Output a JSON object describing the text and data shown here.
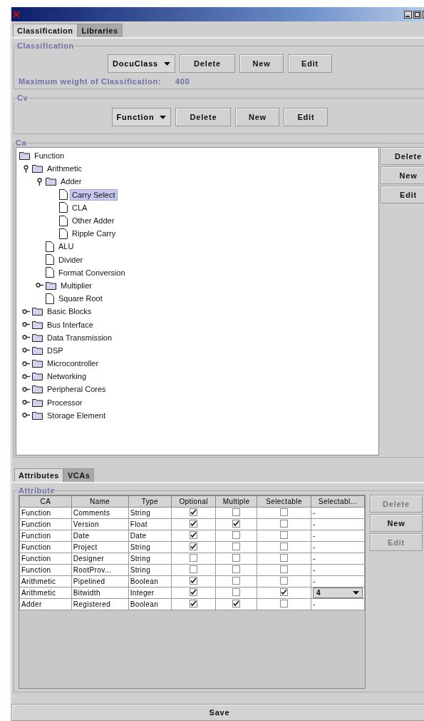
{
  "tabs": [
    {
      "label": "Classification",
      "selected": true
    },
    {
      "label": "Libraries",
      "selected": false
    }
  ],
  "classification": {
    "title": "Classification",
    "dropdown": "DocuClass",
    "buttons": [
      {
        "label": "Delete",
        "disabled": false
      },
      {
        "label": "New",
        "disabled": false
      },
      {
        "label": "Edit",
        "disabled": false
      }
    ],
    "weight_label": "Maximum weight of Classification:",
    "weight_value": "400"
  },
  "cv": {
    "title": "Cv",
    "dropdown": "Function",
    "buttons": [
      {
        "label": "Delete",
        "disabled": false
      },
      {
        "label": "New",
        "disabled": false
      },
      {
        "label": "Edit",
        "disabled": false
      }
    ]
  },
  "ca": {
    "title": "Ca",
    "buttons": [
      {
        "label": "Delete",
        "disabled": false
      },
      {
        "label": "New",
        "disabled": false
      },
      {
        "label": "Edit",
        "disabled": false
      }
    ],
    "tree": {
      "label": "Function",
      "kind": "folder",
      "selected": false,
      "children": [
        {
          "label": "Arithmetic",
          "kind": "folder",
          "expanded": true,
          "selected": false,
          "children": [
            {
              "label": "Adder",
              "kind": "folder",
              "expanded": true,
              "selected": false,
              "children": [
                {
                  "label": "Carry Select",
                  "kind": "leaf",
                  "selected": true
                },
                {
                  "label": "CLA",
                  "kind": "leaf",
                  "selected": false
                },
                {
                  "label": "Other Adder",
                  "kind": "leaf",
                  "selected": false
                },
                {
                  "label": "Ripple Carry",
                  "kind": "leaf",
                  "selected": false
                }
              ]
            },
            {
              "label": "ALU",
              "kind": "leaf",
              "selected": false
            },
            {
              "label": "Divider",
              "kind": "leaf",
              "selected": false
            },
            {
              "label": "Format Conversion",
              "kind": "leaf",
              "selected": false
            },
            {
              "label": "Multiplier",
              "kind": "folder",
              "expanded": false,
              "selected": false
            },
            {
              "label": "Square Root",
              "kind": "leaf",
              "selected": false
            }
          ]
        },
        {
          "label": "Basic Blocks",
          "kind": "folder",
          "expanded": false,
          "selected": false
        },
        {
          "label": "Bus Interface",
          "kind": "folder",
          "expanded": false,
          "selected": false
        },
        {
          "label": "Data Transmission",
          "kind": "folder",
          "expanded": false,
          "selected": false
        },
        {
          "label": "DSP",
          "kind": "folder",
          "expanded": false,
          "selected": false
        },
        {
          "label": "Microcontroller",
          "kind": "folder",
          "expanded": false,
          "selected": false
        },
        {
          "label": "Networking",
          "kind": "folder",
          "expanded": false,
          "selected": false
        },
        {
          "label": "Peripheral Cores",
          "kind": "folder",
          "expanded": false,
          "selected": false
        },
        {
          "label": "Processor",
          "kind": "folder",
          "expanded": false,
          "selected": false
        },
        {
          "label": "Storage Element",
          "kind": "folder",
          "expanded": false,
          "selected": false
        }
      ]
    }
  },
  "sub_tabs": [
    {
      "label": "Attributes",
      "selected": true
    },
    {
      "label": "VCAs",
      "selected": false
    }
  ],
  "attribute": {
    "title": "Attribute",
    "buttons": [
      {
        "label": "Delete",
        "disabled": true
      },
      {
        "label": "New",
        "disabled": false
      },
      {
        "label": "Edit",
        "disabled": true
      }
    ],
    "columns": [
      "CA",
      "Name",
      "Type",
      "Optional",
      "Multiple",
      "Selectable",
      "Selectabl..."
    ],
    "rows": [
      {
        "ca": "Function",
        "name": "Comments",
        "type": "String",
        "optional": true,
        "multiple": false,
        "selectable": false,
        "value": {
          "kind": "text",
          "text": "-"
        }
      },
      {
        "ca": "Function",
        "name": "Version",
        "type": "Float",
        "optional": true,
        "multiple": true,
        "selectable": false,
        "value": {
          "kind": "text",
          "text": "-"
        }
      },
      {
        "ca": "Function",
        "name": "Date",
        "type": "Date",
        "optional": true,
        "multiple": false,
        "selectable": false,
        "value": {
          "kind": "text",
          "text": "-"
        }
      },
      {
        "ca": "Function",
        "name": "Project",
        "type": "String",
        "optional": true,
        "multiple": false,
        "selectable": false,
        "value": {
          "kind": "text",
          "text": "-"
        }
      },
      {
        "ca": "Function",
        "name": "Designer",
        "type": "String",
        "optional": false,
        "multiple": false,
        "selectable": false,
        "value": {
          "kind": "text",
          "text": "-"
        }
      },
      {
        "ca": "Function",
        "name": "RootProv...",
        "type": "String",
        "optional": false,
        "multiple": false,
        "selectable": false,
        "value": {
          "kind": "text",
          "text": "-"
        }
      },
      {
        "ca": "Arithmetic",
        "name": "Pipelined",
        "type": "Boolean",
        "optional": true,
        "multiple": false,
        "selectable": false,
        "value": {
          "kind": "text",
          "text": "-"
        }
      },
      {
        "ca": "Arithmetic",
        "name": "Bitwidth",
        "type": "Integer",
        "optional": true,
        "multiple": false,
        "selectable": true,
        "value": {
          "kind": "dropdown",
          "text": "4"
        }
      },
      {
        "ca": "Adder",
        "name": "Registered",
        "type": "Boolean",
        "optional": true,
        "multiple": true,
        "selectable": false,
        "value": {
          "kind": "text",
          "text": "-"
        }
      }
    ]
  },
  "save_button": "Save"
}
